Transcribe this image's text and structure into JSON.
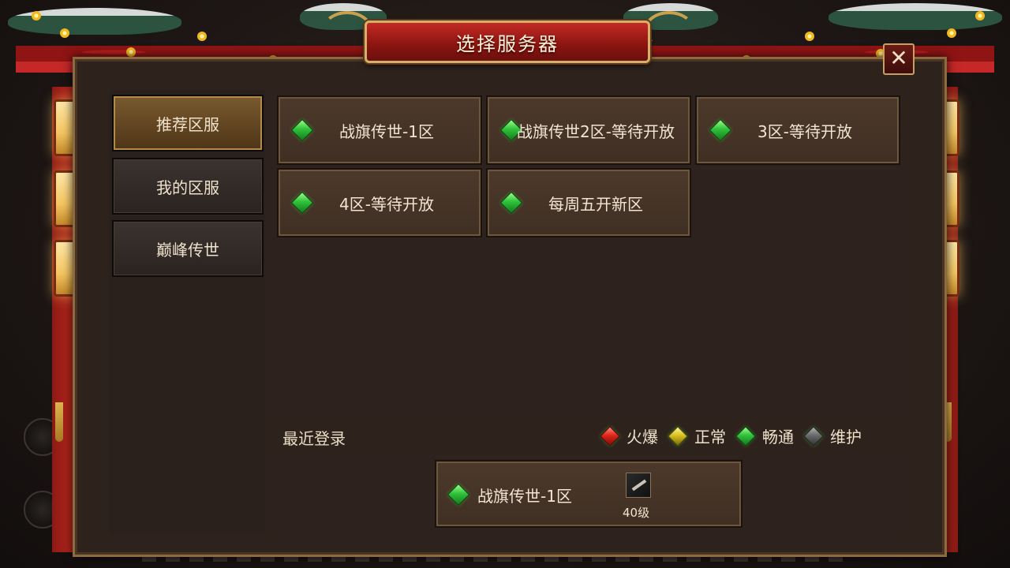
{
  "window": {
    "title": "选择服务器",
    "close_symbol": "✕"
  },
  "tabs": [
    {
      "label": "推荐区服",
      "active": true
    },
    {
      "label": "我的区服",
      "active": false
    },
    {
      "label": "巅峰传世",
      "active": false
    }
  ],
  "servers": [
    {
      "name": "战旗传世-1区",
      "status": "畅通"
    },
    {
      "name": "战旗传世2区-等待开放",
      "status": "畅通"
    },
    {
      "name": "3区-等待开放",
      "status": "畅通"
    },
    {
      "name": "4区-等待开放",
      "status": "畅通"
    },
    {
      "name": "每周五开新区",
      "status": "畅通"
    }
  ],
  "recent": {
    "label": "最近登录",
    "server_name": "战旗传世-1区",
    "level": "40级"
  },
  "legend": [
    {
      "label": "火爆",
      "color": "#e0261a"
    },
    {
      "label": "正常",
      "color": "#d8c21e"
    },
    {
      "label": "畅通",
      "color": "#2fc23a"
    },
    {
      "label": "维护",
      "color": "#6a6a6a"
    }
  ]
}
